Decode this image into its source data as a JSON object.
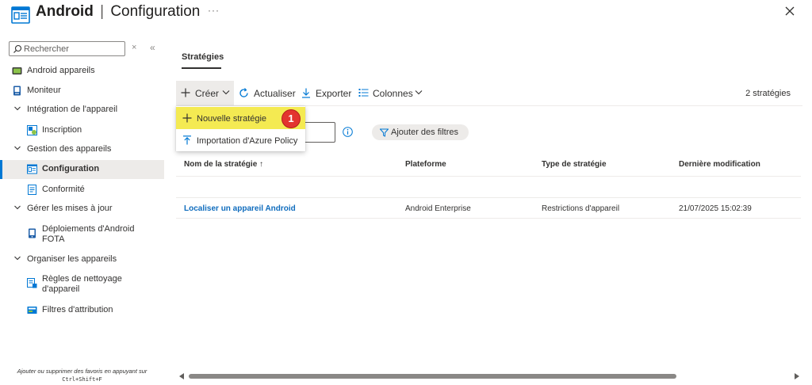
{
  "header": {
    "title_bold": "Android",
    "separator": "|",
    "title_sub": "Configuration",
    "more": "···",
    "close_icon": "close-icon"
  },
  "sidebar": {
    "search_placeholder": "Rechercher",
    "clear_glyph": "×",
    "collapse_glyph": "«",
    "items": [
      {
        "label": "Android appareils",
        "icon": "device-icon"
      },
      {
        "label": "Moniteur",
        "icon": "monitor-icon"
      },
      {
        "label": "Intégration de l'appareil",
        "icon": "chevron-down-icon",
        "group": true
      },
      {
        "label": "Inscription",
        "icon": "enroll-icon"
      },
      {
        "label": "Gestion des appareils",
        "icon": "chevron-down-icon",
        "group": true
      },
      {
        "label": "Configuration",
        "icon": "configuration-icon",
        "active": true
      },
      {
        "label": "Conformité",
        "icon": "compliance-icon"
      },
      {
        "label": "Gérer les mises à jour",
        "icon": "chevron-down-icon",
        "group": true
      },
      {
        "label": "Déploiements d'Android FOTA",
        "icon": "fota-icon"
      },
      {
        "label": "Organiser les appareils",
        "icon": "chevron-down-icon",
        "group": true
      },
      {
        "label": "Règles de nettoyage d'appareil",
        "icon": "cleanup-icon"
      },
      {
        "label": "Filtres d'attribution",
        "icon": "filter-icon"
      }
    ],
    "hint_line1": "Ajouter ou supprimer des favoris en appuyant sur",
    "hint_shortcut": "Ctrl+Shift+F"
  },
  "main": {
    "tab": "Stratégies",
    "toolbar": {
      "create": "Créer",
      "refresh": "Actualiser",
      "export": "Exporter",
      "columns": "Colonnes",
      "count": "2 stratégies"
    },
    "dropdown": {
      "items": [
        {
          "label": "Nouvelle stratégie",
          "icon": "plus-icon",
          "highlighted": true
        },
        {
          "label": "Importation d'Azure Policy",
          "icon": "upload-icon"
        }
      ],
      "badge": "1"
    },
    "filters_label": "Ajouter des filtres",
    "table": {
      "columns": [
        "Nom de la stratégie",
        "Plateforme",
        "Type de stratégie",
        "Dernière modification"
      ],
      "sort_indicator": "↑",
      "rows": [
        [
          "Localiser un appareil Android",
          "Android Enterprise",
          "Restrictions d'appareil",
          "21/07/2025 15:02:39"
        ]
      ]
    }
  },
  "colors": {
    "accent": "#0078d4",
    "link": "#0f6cbd",
    "highlight": "#f4ea52",
    "badge": "#e3342f"
  }
}
